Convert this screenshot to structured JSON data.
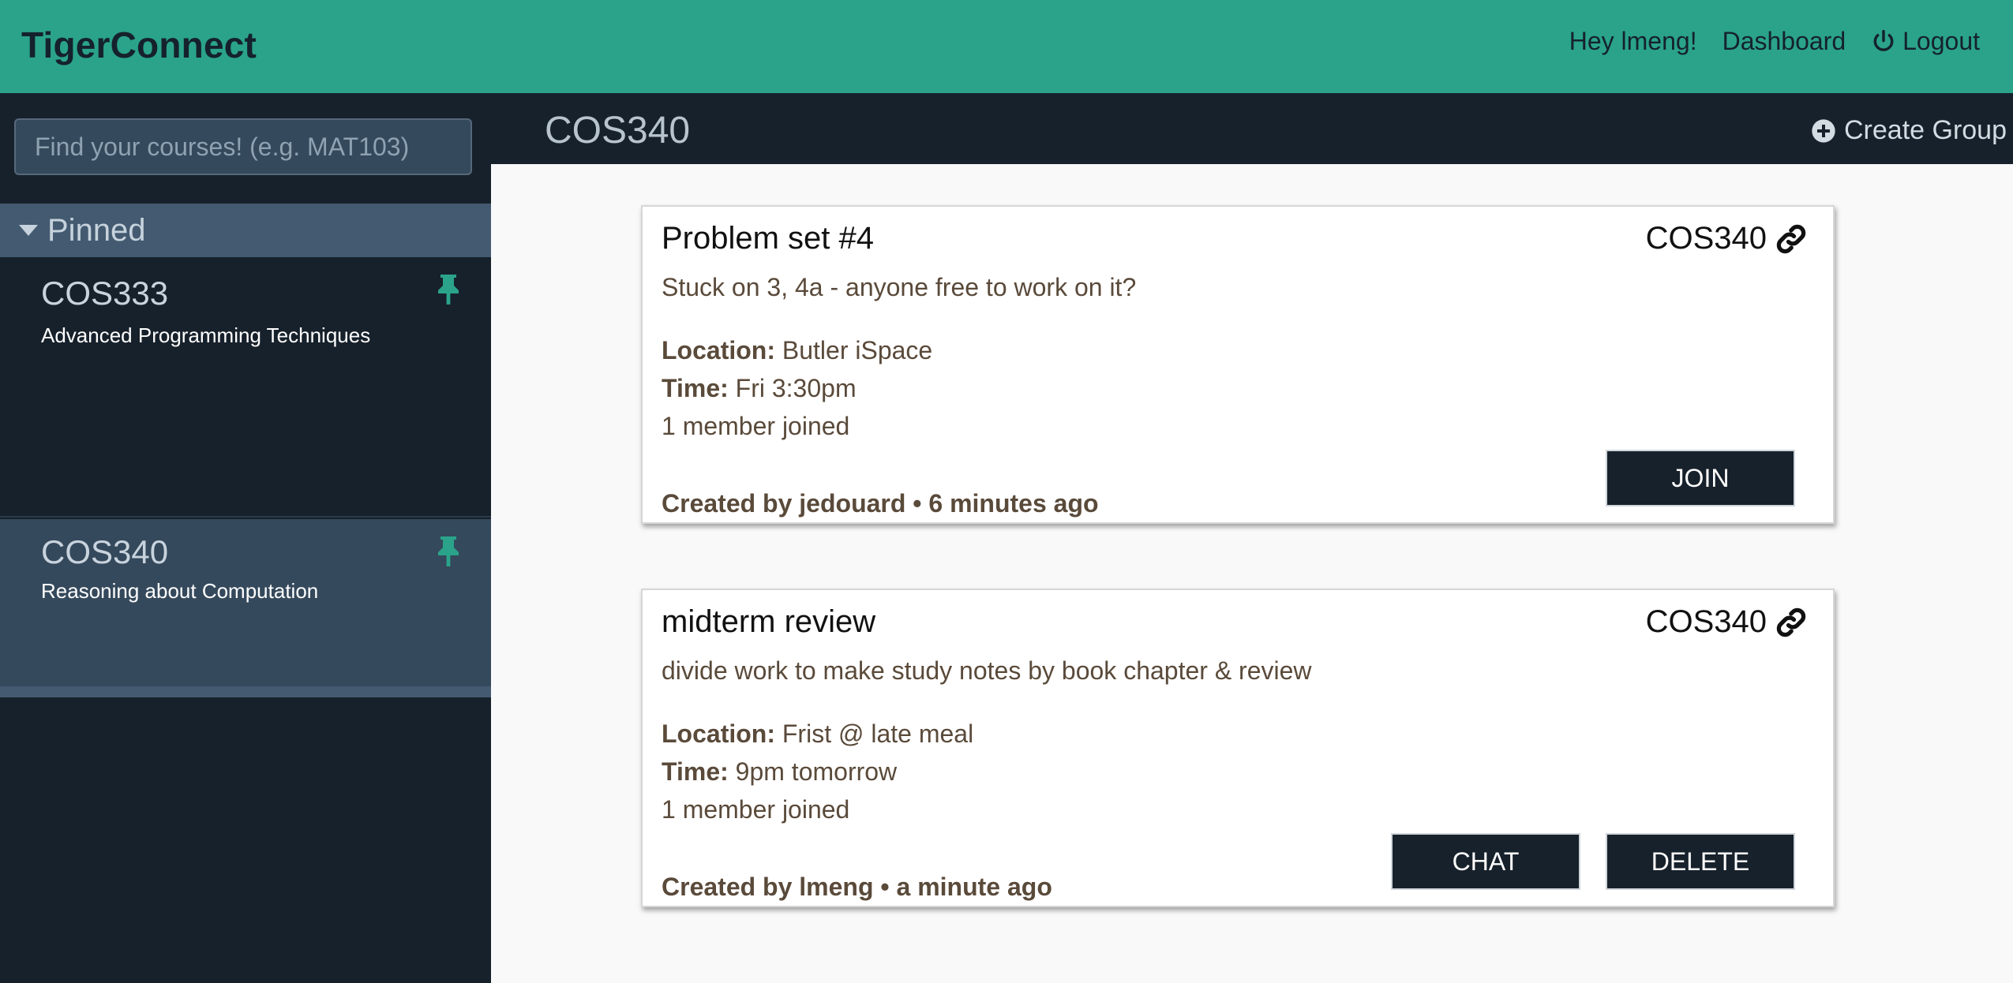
{
  "navbar": {
    "brand": "TigerConnect",
    "greeting": "Hey lmeng!",
    "dashboard": "Dashboard",
    "logout": "Logout"
  },
  "sidebar": {
    "search_placeholder": "Find your courses! (e.g. MAT103)",
    "pinned_label": "Pinned",
    "courses": [
      {
        "code": "COS333",
        "title": "Advanced Programming Techniques",
        "icon": "pin-icon"
      },
      {
        "code": "COS340",
        "title": "Reasoning about Computation",
        "icon": "pin-icon"
      }
    ]
  },
  "main": {
    "course_title": "COS340",
    "create_group": "Create Group",
    "groups": [
      {
        "title": "Problem set #4",
        "course": "COS340",
        "description": "Stuck on 3, 4a - anyone free to work on it?",
        "location_label": "Location:",
        "location": "Butler iSpace",
        "time_label": "Time:",
        "time": "Fri 3:30pm",
        "members": "1 member joined",
        "created": "Created by jedouard • 6 minutes ago",
        "buttons": [
          "JOIN"
        ]
      },
      {
        "title": "midterm review",
        "course": "COS340",
        "description": "divide work to make study notes by book chapter & review",
        "location_label": "Location:",
        "location": "Frist @ late meal",
        "time_label": "Time:",
        "time": "9pm tomorrow",
        "members": "1 member joined",
        "created": "Created by lmeng • a minute ago",
        "buttons": [
          "CHAT",
          "DELETE"
        ]
      }
    ]
  },
  "colors": {
    "navbar": "#2aa38a",
    "sidebar": "#17212b",
    "pinned_header": "#435a70",
    "accent_pin": "#2aa38a",
    "button": "#17212b"
  }
}
